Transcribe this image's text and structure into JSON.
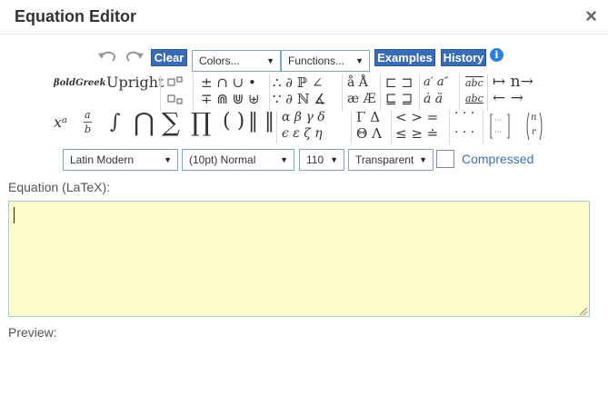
{
  "dialog": {
    "title": "Equation Editor",
    "close_glyph": "×"
  },
  "toolbar": {
    "undo_icon": "undo-icon",
    "redo_icon": "redo-icon",
    "clear_label": "Clear",
    "colors_select": "Colors...",
    "functions_select": "Functions...",
    "examples_label": "Examples",
    "history_label": "History",
    "info_glyph": "i"
  },
  "palette": {
    "boldgreek": "𝜷𝒐𝒍𝒅𝑮𝒓𝒆𝒆𝒌",
    "upright": "Upright",
    "ops_row1": "± ∩ ∪ •",
    "ops_row2": "∓ ⋒ ⋓ ⊎",
    "misc_row1": "∴ ∂ ℙ ∠",
    "misc_row2": "∵ ∂ ℕ ∡",
    "accent_row1": "å Å",
    "accent_row2": "æ Æ",
    "sub_row1": "⊏ ⊐",
    "sub_row2": "⊑ ⊒",
    "prime_row1": "a′ a″",
    "prime_row2": "ȧ ä",
    "over_abc": "abc",
    "under_abc": "abc",
    "arrow_row1": "↦ n→",
    "arrow_row2": "← →",
    "sup": "xᵃ",
    "frac_num": "a",
    "frac_den": "b",
    "integral": "∫",
    "bigcap": "⋂",
    "sum": "∑",
    "prod": "∏",
    "parens": "( )",
    "norms": "‖ ‖",
    "greek_row1": "α β γ δ",
    "greek_row2": "ϵ ε ζ η",
    "cap_greek_row1": "Γ Δ",
    "cap_greek_row2": "Θ Λ",
    "rel_row1": "< > =",
    "rel_row2": "≤ ≥ ≐",
    "dots_row1": "· · ·",
    "dots_row2": "· · ·",
    "matrix": "[⋯ ⋯]",
    "binom_n": "n",
    "binom_r": "r"
  },
  "options": {
    "font": "Latin Modern",
    "size": "(10pt) Normal",
    "dpi": "110",
    "background": "Transparent",
    "compressed_label": "Compressed",
    "compressed_checked": false
  },
  "equation": {
    "label": "Equation (LaTeX):",
    "value": ""
  },
  "preview": {
    "label": "Preview:"
  },
  "colors": {
    "button_blue": "#3a6cb4",
    "editor_bg": "#fefccc",
    "link_blue": "#3d6fa8"
  }
}
